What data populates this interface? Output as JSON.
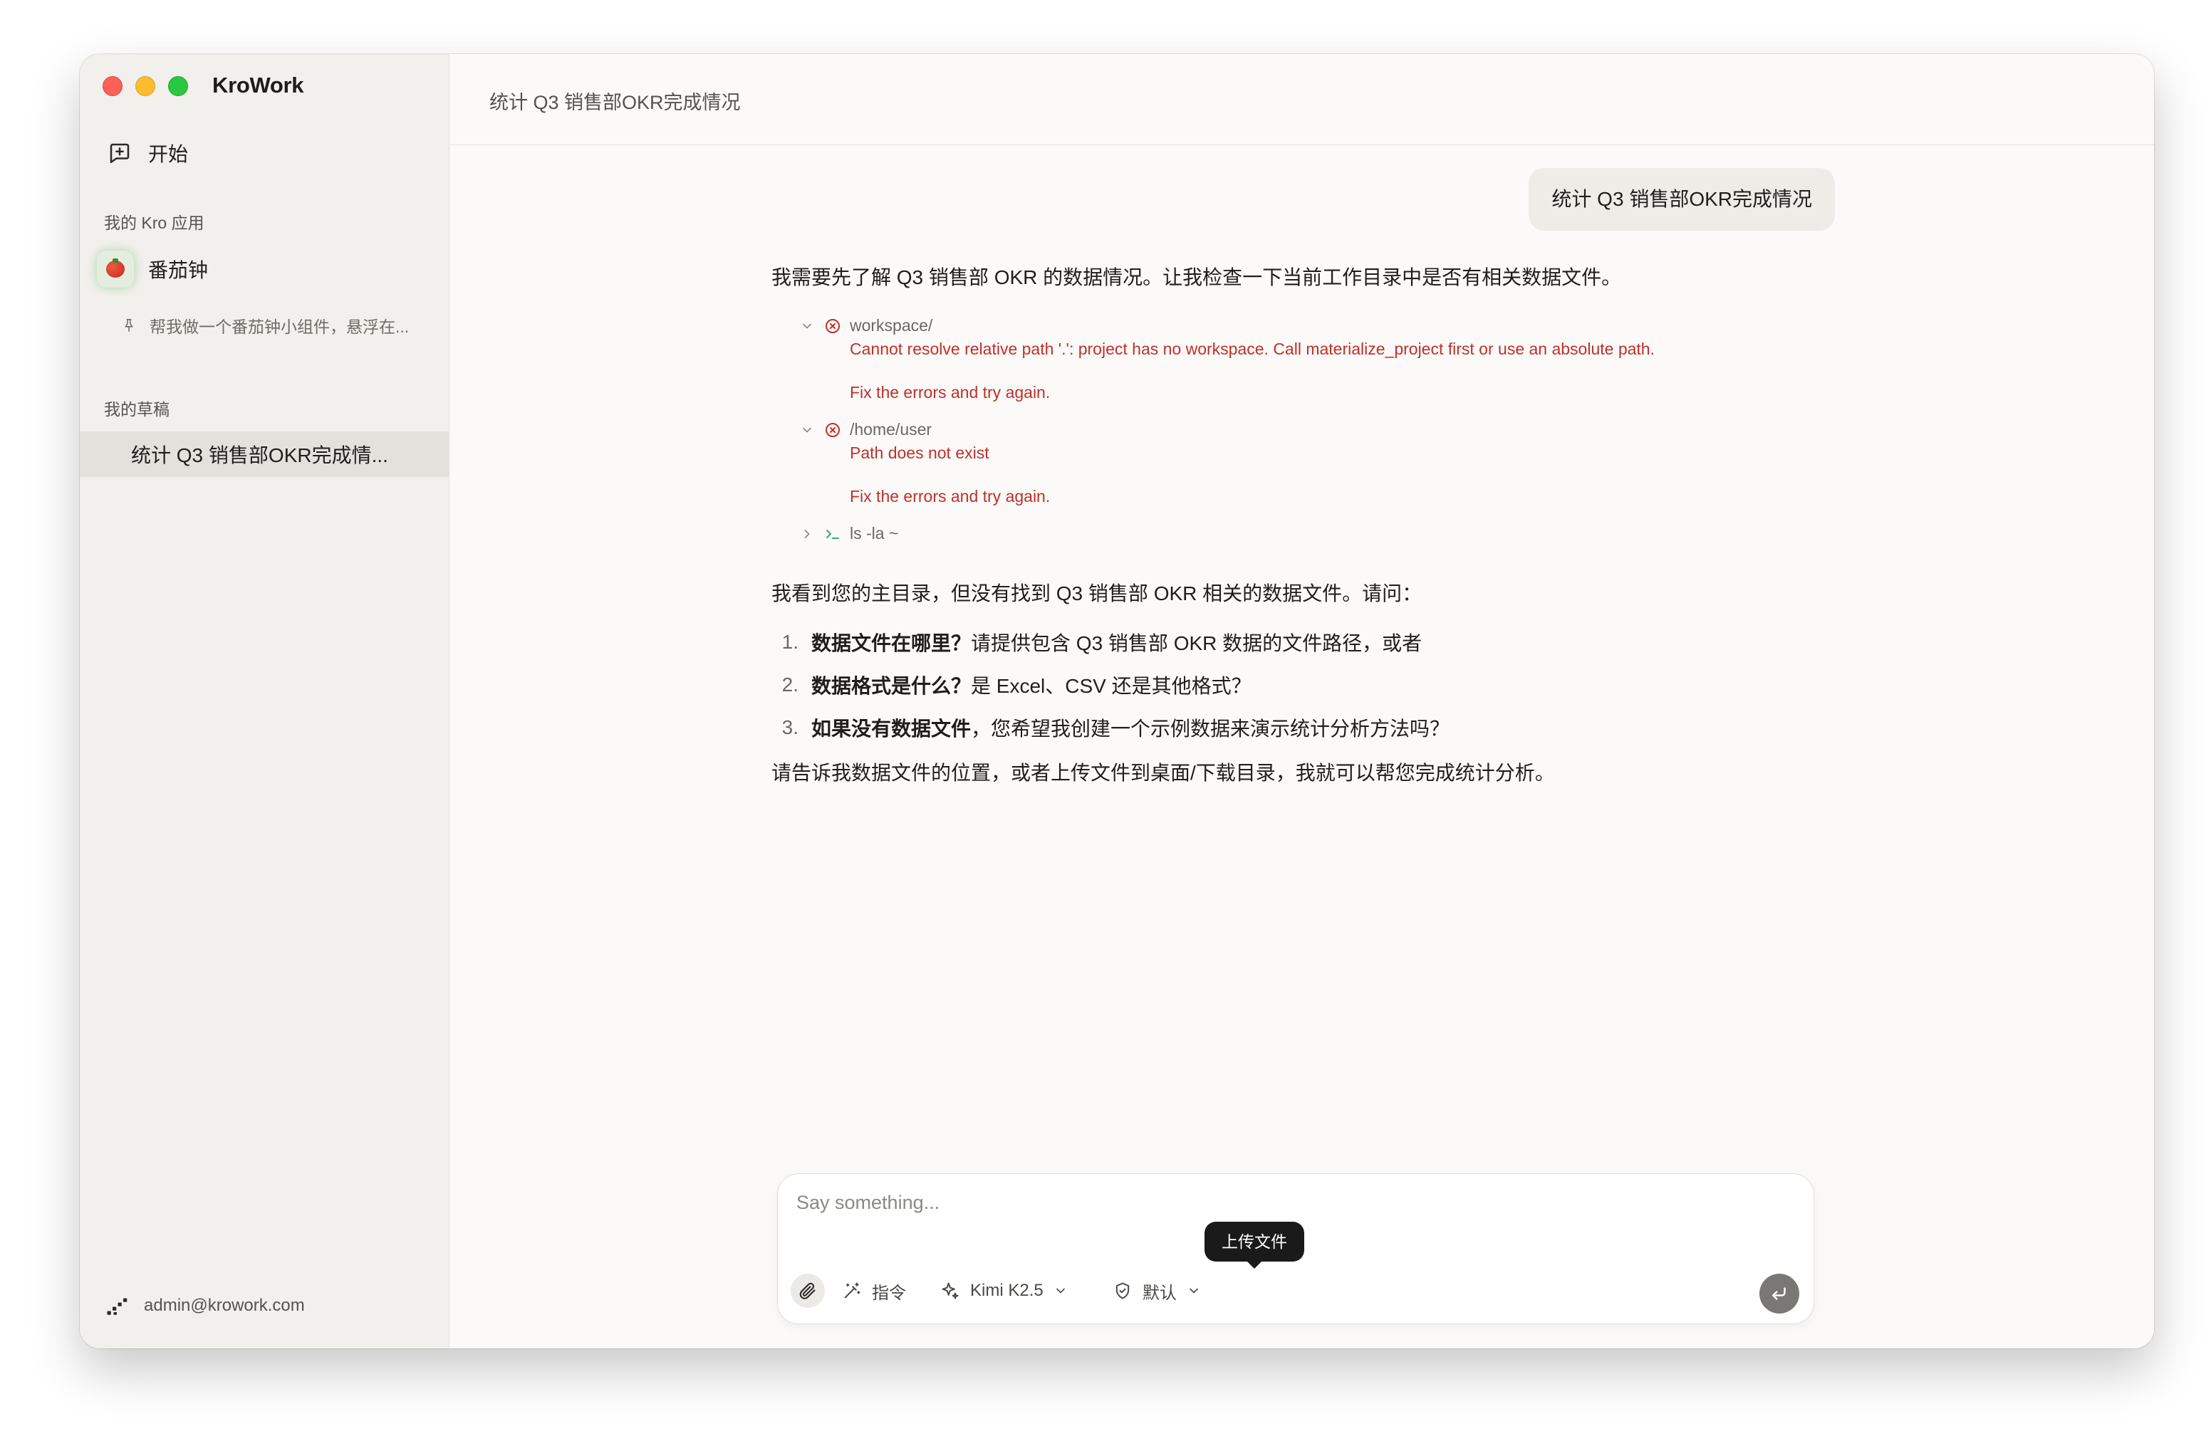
{
  "app": {
    "name": "KroWork"
  },
  "sidebar": {
    "start_label": "开始",
    "apps_section_label": "我的 Kro 应用",
    "app_item": {
      "label": "番茄钟",
      "subtitle": "帮我做一个番茄钟小组件，悬浮在..."
    },
    "drafts_section_label": "我的草稿",
    "draft_item": {
      "label": "统计 Q3 销售部OKR完成情..."
    },
    "account_email": "admin@krowork.com"
  },
  "header": {
    "title": "统计 Q3 销售部OKR完成情况"
  },
  "conversation": {
    "user_message": "统计 Q3 销售部OKR完成情况",
    "intro": "我需要先了解 Q3 销售部 OKR 的数据情况。让我检查一下当前工作目录中是否有相关数据文件。",
    "tool_calls": [
      {
        "name": "workspace/",
        "error": "Cannot resolve relative path '.': project has no workspace. Call materialize_project first or use an absolute path.",
        "hint": "Fix the errors and try again."
      },
      {
        "name": "/home/user",
        "error": "Path does not exist",
        "hint": "Fix the errors and try again."
      },
      {
        "name": "ls -la ~"
      }
    ],
    "followup": "我看到您的主目录，但没有找到 Q3 销售部 OKR 相关的数据文件。请问：",
    "questions": [
      {
        "num": "1.",
        "bold": "数据文件在哪里？",
        "text": " 请提供包含 Q3 销售部 OKR 数据的文件路径，或者"
      },
      {
        "num": "2.",
        "bold": "数据格式是什么？",
        "text": " 是 Excel、CSV 还是其他格式？"
      },
      {
        "num": "3.",
        "bold": "如果没有数据文件",
        "text": "，您希望我创建一个示例数据来演示统计分析方法吗？"
      }
    ],
    "closing": "请告诉我数据文件的位置，或者上传文件到桌面/下载目录，我就可以帮您完成统计分析。"
  },
  "composer": {
    "placeholder": "Say something...",
    "attach_tooltip": "上传文件",
    "command_label": "指令",
    "model_label": "Kimi K2.5",
    "permission_label": "默认"
  },
  "colors": {
    "error": "#c0302a",
    "sidebar_bg": "#f2f0ec",
    "main_bg": "#fbfaf8",
    "accent_green": "#3aa86b"
  },
  "icons": [
    "new-chat-icon",
    "tomato-icon",
    "pin-icon",
    "account-icon",
    "chevron-down-icon",
    "chevron-right-icon",
    "error-circle-icon",
    "terminal-icon",
    "paperclip-icon",
    "magic-wand-icon",
    "sparkle-icon",
    "shield-icon",
    "send-icon"
  ]
}
